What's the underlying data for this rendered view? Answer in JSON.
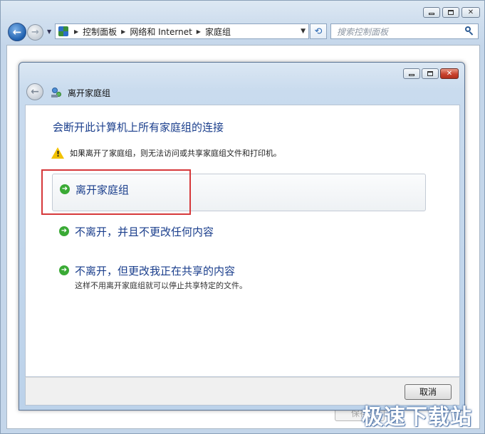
{
  "outer_window": {
    "address_crumbs": [
      "控制面板",
      "网络和 Internet",
      "家庭组"
    ],
    "search_placeholder": "搜索控制面板",
    "background_button_label": "保存"
  },
  "dialog": {
    "title": "离开家庭组",
    "main_instruction": "会断开此计算机上所有家庭组的连接",
    "warning": "如果离开了家庭组，则无法访问或共享家庭组文件和打印机。",
    "options": [
      {
        "title": "离开家庭组",
        "description": ""
      },
      {
        "title": "不离开，并且不更改任何内容",
        "description": ""
      },
      {
        "title": "不离开，但更改我正在共享的内容",
        "description": "这样不用离开家庭组就可以停止共享特定的文件。"
      }
    ],
    "cancel_label": "取消"
  },
  "watermark": "极速下载站",
  "colors": {
    "link_blue": "#1a3e8c",
    "arrow_green": "#3aaa35",
    "highlight_red": "#d6383a",
    "close_red": "#c9432e"
  },
  "icons": {
    "back": "back-arrow-icon",
    "forward": "forward-arrow-icon",
    "refresh": "refresh-icon",
    "search": "search-icon",
    "warning": "warning-icon",
    "homegroup": "homegroup-icon",
    "option_arrow": "green-arrow-icon"
  }
}
